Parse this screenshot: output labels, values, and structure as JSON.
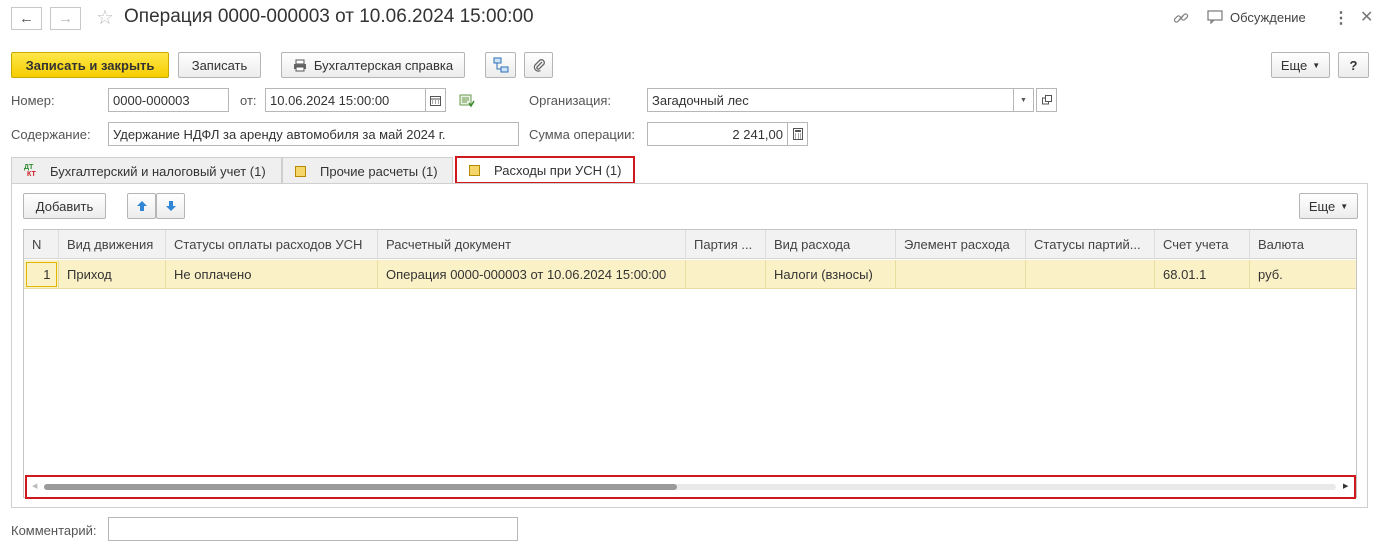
{
  "window": {
    "title": "Операция 0000-000003 от 10.06.2024 15:00:00",
    "discussion_label": "Обсуждение"
  },
  "toolbar": {
    "save_close": "Записать и закрыть",
    "save": "Записать",
    "accounting_note": "Бухгалтерская справка",
    "more": "Еще",
    "help": "?"
  },
  "form": {
    "number_label": "Номер:",
    "number_value": "0000-000003",
    "date_label": "от:",
    "date_value": "10.06.2024 15:00:00",
    "org_label": "Организация:",
    "org_value": "Загадочный лес",
    "content_label": "Содержание:",
    "content_value": "Удержание НДФЛ за аренду автомобиля за май 2024 г.",
    "sum_label": "Сумма операции:",
    "sum_value": "2 241,00",
    "comment_label": "Комментарий:",
    "comment_value": ""
  },
  "tabs": [
    {
      "label": "Бухгалтерский и налоговый учет (1)",
      "icon": "dt-kt-icon"
    },
    {
      "label": "Прочие расчеты (1)",
      "icon": "document-icon"
    },
    {
      "label": "Расходы при УСН (1)",
      "icon": "document-icon",
      "active": true
    }
  ],
  "table_toolbar": {
    "add": "Добавить",
    "more": "Еще"
  },
  "table": {
    "columns": [
      "N",
      "Вид движения",
      "Статусы оплаты расходов УСН",
      "Расчетный документ",
      "Партия ...",
      "Вид расхода",
      "Элемент расхода",
      "Статусы партий...",
      "Счет учета",
      "Валюта"
    ],
    "rows": [
      [
        "1",
        "Приход",
        "Не оплачено",
        "Операция 0000-000003 от 10.06.2024 15:00:00",
        "",
        "Налоги (взносы)",
        "",
        "",
        "68.01.1",
        "руб."
      ]
    ]
  },
  "colors": {
    "accent_yellow": "#f5cd00",
    "highlight_red": "#d0191f",
    "row_selected": "#fbf1c6"
  },
  "scroll": {
    "horizontal_position_fraction": 0.49
  }
}
